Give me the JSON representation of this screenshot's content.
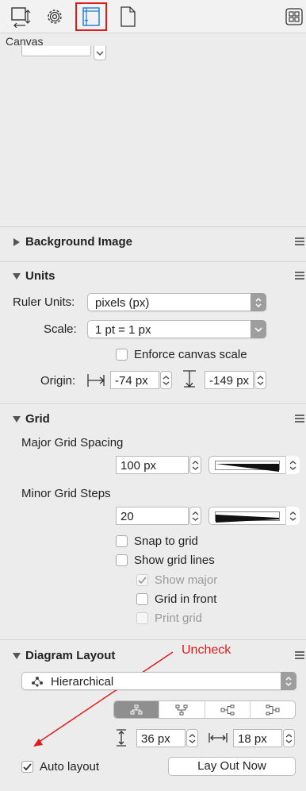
{
  "inspector_tabs": [
    {
      "name": "object-tab",
      "icon": "bounds-icon"
    },
    {
      "name": "properties-tab",
      "icon": "gear-icon"
    },
    {
      "name": "canvas-tab",
      "icon": "canvas-ruler-icon",
      "selected": true
    },
    {
      "name": "document-tab",
      "icon": "page-icon"
    },
    {
      "name": "layout-toggle",
      "icon": "grid-icon"
    }
  ],
  "panel_title": "Canvas",
  "background_image": {
    "title": "Background Image"
  },
  "units": {
    "title": "Units",
    "ruler_units_label": "Ruler Units:",
    "ruler_units_value": "pixels (px)",
    "scale_label": "Scale:",
    "scale_value": "1 pt = 1 px",
    "enforce_scale_label": "Enforce canvas scale",
    "origin_label": "Origin:",
    "origin_x": "-74 px",
    "origin_y": "-149 px"
  },
  "grid": {
    "title": "Grid",
    "major_spacing_label": "Major Grid Spacing",
    "major_spacing_value": "100 px",
    "minor_steps_label": "Minor Grid Steps",
    "minor_steps_value": "20",
    "snap_label": "Snap to grid",
    "show_lines_label": "Show grid lines",
    "show_major_label": "Show major",
    "in_front_label": "Grid in front",
    "print_label": "Print grid"
  },
  "diagram_layout": {
    "title": "Diagram Layout",
    "type_value": "Hierarchical",
    "rank_spacing": "36 px",
    "object_spacing": "18 px",
    "auto_layout_label": "Auto layout",
    "lay_out_now_label": "Lay Out Now"
  },
  "annotation": {
    "text": "Uncheck",
    "color": "#e01b1b"
  }
}
